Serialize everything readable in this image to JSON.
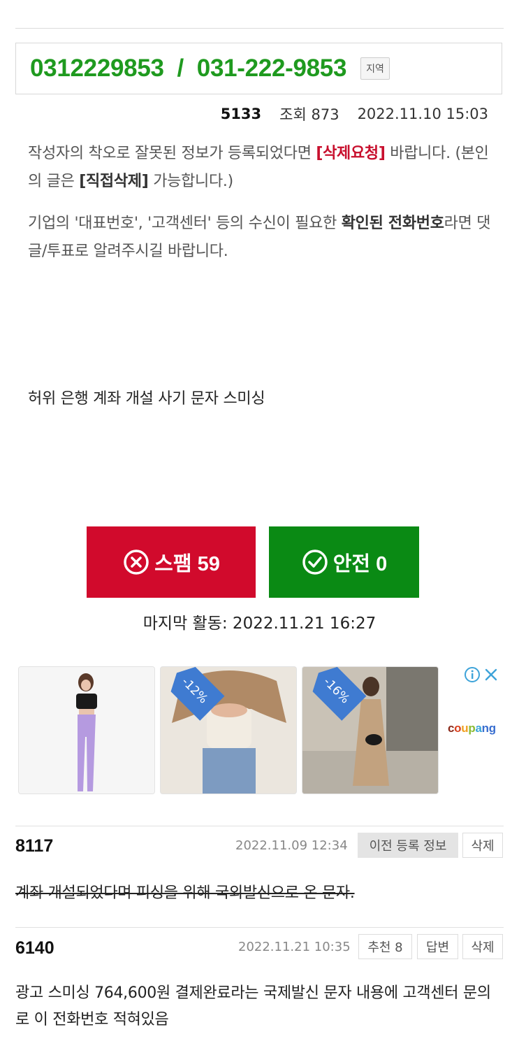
{
  "phone": {
    "number": "0312229853  /  031-222-9853",
    "region_tag": "지역"
  },
  "meta": {
    "post_id": "5133",
    "views": "조회 873",
    "date": "2022.11.10 15:03"
  },
  "notice": {
    "line1_a": "작성자의 착오로 잘못된 정보가 등록되었다면 ",
    "line1_delete_request": "[삭제요청]",
    "line1_b": " 바랍니다. (본인의 글은 ",
    "line1_direct_delete": "[직접삭제]",
    "line1_c": " 가능합니다.)",
    "line2_a": "기업의 '대표번호', '고객센터' 등의 수신이 필요한 ",
    "line2_bold": "확인된 전화번호",
    "line2_b": "라면 댓글/투표로 알려주시길 바랍니다."
  },
  "post": {
    "body": "허위 은행 계좌 개설 사기 문자 스미싱"
  },
  "votes": {
    "spam_label": "스팸 59",
    "safe_label": "안전 0",
    "spam_color": "#d10a2c",
    "safe_color": "#0a8a14",
    "last_activity": "마지막 활동: 2022.11.21 16:27"
  },
  "ads": {
    "items": [
      {
        "discount": ""
      },
      {
        "discount": "-12%"
      },
      {
        "discount": "-16%"
      }
    ],
    "brand": "coupang",
    "info_icon": "info-icon",
    "close_icon": "close-icon"
  },
  "comments": [
    {
      "id": "8117",
      "date": "2022.11.09 12:34",
      "btn_prev": "이전 등록 정보",
      "btn_delete": "삭제",
      "text": "계좌 개설되었다며 피싱을 위해 국외발신으로 온 문자."
    },
    {
      "id": "6140",
      "date": "2022.11.21 10:35",
      "btn_recommend": "추천 8",
      "btn_reply": "답변",
      "btn_delete": "삭제",
      "text": "광고 스미싱 764,600원 결제완료라는 국제발신 문자 내용에 고객센터 문의로 이 전화번호 적혀있음"
    }
  ]
}
